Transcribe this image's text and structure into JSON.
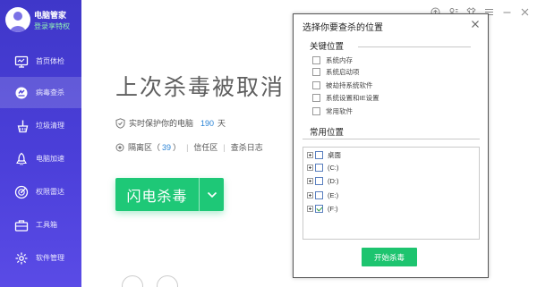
{
  "sidebar": {
    "app_name": "电脑管家",
    "login_link": "登录享特权",
    "items": [
      {
        "label": "首页体检",
        "icon": "monitor-icon",
        "active": false
      },
      {
        "label": "病毒查杀",
        "icon": "virus-scan-icon",
        "active": true
      },
      {
        "label": "垃圾清理",
        "icon": "broom-icon",
        "active": false
      },
      {
        "label": "电脑加速",
        "icon": "rocket-icon",
        "active": false
      },
      {
        "label": "权限雷达",
        "icon": "radar-icon",
        "active": false
      },
      {
        "label": "工具箱",
        "icon": "toolbox-icon",
        "active": false
      },
      {
        "label": "软件管理",
        "icon": "software-manager-icon",
        "active": false
      }
    ]
  },
  "main": {
    "status_title": "上次杀毒被取消",
    "protect_text": "实时保护你的电脑",
    "protect_days": "190",
    "protect_days_unit": "天",
    "quarantine_label": "隔离区",
    "quarantine_count_open": "（",
    "quarantine_count": "39",
    "quarantine_count_close": "）",
    "trust_zone_label": "信任区",
    "scan_log_label": "查杀日志",
    "scan_button_label": "闪电杀毒"
  },
  "dialog": {
    "title": "选择你要查杀的位置",
    "key_section_title": "关键位置",
    "key_locations": [
      "系统内存",
      "系统启动项",
      "被劫持系统软件",
      "系统设置和IE设置",
      "常用软件"
    ],
    "common_section_title": "常用位置",
    "drives": [
      {
        "label": "桌面",
        "checked": false
      },
      {
        "label": "(C:)",
        "checked": false
      },
      {
        "label": "(D:)",
        "checked": false
      },
      {
        "label": "(E:)",
        "checked": false
      },
      {
        "label": "(F:)",
        "checked": true
      }
    ],
    "start_button_label": "开始杀毒"
  },
  "colors": {
    "sidebar": "#4439d4",
    "accent_green": "#1ec877",
    "link_blue": "#2b84d6",
    "login_green": "#8ff0b4"
  }
}
